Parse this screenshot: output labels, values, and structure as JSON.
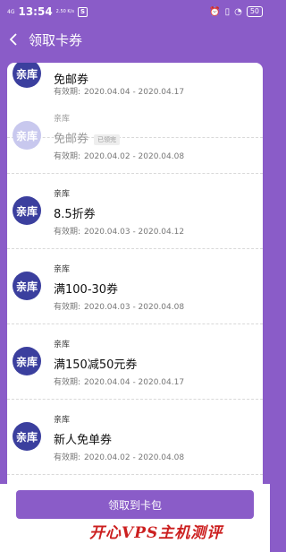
{
  "status_bar": {
    "network": "4G",
    "time": "13:54",
    "speed": "2.50 K/s",
    "battery": "50"
  },
  "header": {
    "back_icon": "chevron-left-icon",
    "title": "领取卡券"
  },
  "coupons": [
    {
      "brand": "",
      "name": "免邮券",
      "validity_label": "有效期:",
      "dates": "2020.04.04 - 2020.04.17",
      "used": false,
      "logo": "亲库"
    },
    {
      "brand": "亲库",
      "name": "免邮券",
      "validity_label": "有效期:",
      "dates": "2020.04.02 - 2020.04.08",
      "used": true,
      "used_tag": "已领完",
      "logo": "亲库"
    },
    {
      "brand": "亲库",
      "name": "8.5折券",
      "validity_label": "有效期:",
      "dates": "2020.04.03 - 2020.04.12",
      "used": false,
      "logo": "亲库"
    },
    {
      "brand": "亲库",
      "name": "满100-30券",
      "validity_label": "有效期:",
      "dates": "2020.04.03 - 2020.04.08",
      "used": false,
      "logo": "亲库"
    },
    {
      "brand": "亲库",
      "name": "满150减50元券",
      "validity_label": "有效期:",
      "dates": "2020.04.04 - 2020.04.17",
      "used": false,
      "logo": "亲库"
    },
    {
      "brand": "亲库",
      "name": "新人免单券",
      "validity_label": "有效期:",
      "dates": "2020.04.02 - 2020.04.08",
      "used": false,
      "logo": "亲库"
    }
  ],
  "claim_button": "领取到卡包",
  "watermark": "开心VPS主机测评",
  "colors": {
    "accent": "#8a5cc8",
    "logo": "#3b3f9e",
    "watermark": "#cc1f1f"
  }
}
